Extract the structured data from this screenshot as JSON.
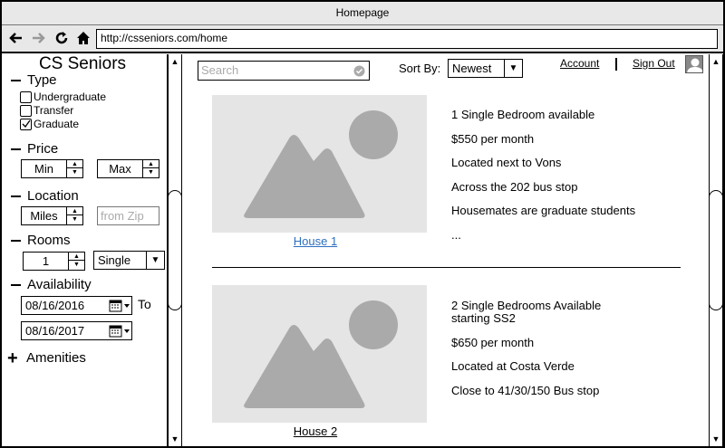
{
  "window": {
    "title": "Homepage"
  },
  "browser": {
    "url": "http://csseniors.com/home",
    "icons": [
      "back-arrow-icon",
      "forward-arrow-icon",
      "reload-icon",
      "home-icon"
    ]
  },
  "sidebar": {
    "title": "CS Seniors",
    "type": {
      "label": "Type",
      "options": [
        {
          "label": "Undergraduate",
          "checked": false
        },
        {
          "label": "Transfer",
          "checked": false
        },
        {
          "label": "Graduate",
          "checked": true
        }
      ]
    },
    "price": {
      "label": "Price",
      "min": "Min",
      "max": "Max"
    },
    "location": {
      "label": "Location",
      "miles": "Miles",
      "zip_placeholder": "from Zip"
    },
    "rooms": {
      "label": "Rooms",
      "count": "1",
      "kind": "Single"
    },
    "availability": {
      "label": "Availability",
      "from": "08/16/2016",
      "to_label": "To",
      "to": "08/16/2017"
    },
    "amenities": {
      "label": "Amenities"
    }
  },
  "header": {
    "search_placeholder": "Search",
    "sort_label": "Sort By:",
    "sort_value": "Newest",
    "account": "Account",
    "sign_out": "Sign Out"
  },
  "listings": [
    {
      "link": "House 1",
      "lines": [
        "1 Single Bedroom available",
        "$550 per month",
        "Located next to Vons",
        "Across the 202 bus stop",
        "Housemates are graduate students",
        "..."
      ]
    },
    {
      "link": "House 2",
      "lines": [
        "2 Single Bedrooms Available",
        "starting SS2",
        "$650 per month",
        "Located at Costa Verde",
        "Close to 41/30/150 Bus stop"
      ]
    }
  ]
}
